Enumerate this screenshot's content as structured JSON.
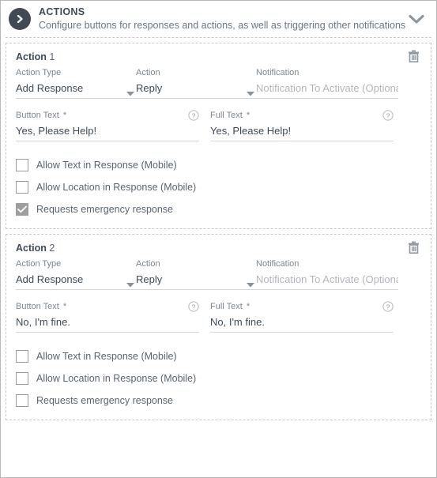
{
  "header": {
    "badge_icon": "chevron-right-circle-icon",
    "title": "ACTIONS",
    "subtitle": "Configure buttons for responses and actions, as well as triggering other notifications",
    "collapse_icon": "chevron-down-icon",
    "accent_dark": "#3f4a55",
    "text_gray": "#6b7680"
  },
  "labels": {
    "action_type": "Action Type",
    "action": "Action",
    "notification": "Notification",
    "button_text": "Button Text",
    "full_text": "Full Text",
    "required_mark": "*",
    "delete_icon": "trash-icon",
    "help_icon": "help-circle-icon",
    "caret_icon": "caret-down-icon",
    "notification_placeholder": "Notification To Activate (Optional)"
  },
  "checkbox_labels": {
    "allow_text": "Allow Text in Response (Mobile)",
    "allow_location": "Allow Location in Response (Mobile)",
    "emergency": "Requests emergency response"
  },
  "cards": [
    {
      "title_word": "Action",
      "title_num": "1",
      "action_type_value": "Add Response",
      "action_value": "Reply",
      "notification_value": "",
      "button_text_value": "Yes, Please Help!",
      "full_text_value": "Yes, Please Help!",
      "allow_text_checked": false,
      "allow_location_checked": false,
      "emergency_checked": true
    },
    {
      "title_word": "Action",
      "title_num": "2",
      "action_type_value": "Add Response",
      "action_value": "Reply",
      "notification_value": "",
      "button_text_value": "No, I'm fine.",
      "full_text_value": "No, I'm fine.",
      "allow_text_checked": false,
      "allow_location_checked": false,
      "emergency_checked": false
    }
  ]
}
